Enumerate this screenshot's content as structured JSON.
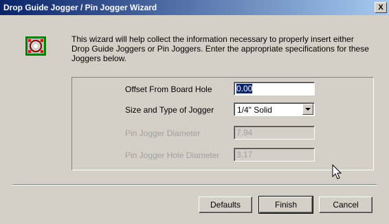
{
  "window": {
    "title": "Drop Guide Jogger / Pin Jogger Wizard",
    "close_label": "X"
  },
  "intro_text": "This wizard will help collect the information necessary to properly insert either Drop Guide Joggers or Pin Joggers.  Enter the appropriate specifications for these Joggers below.",
  "form": {
    "offset_label": "Offset From Board Hole",
    "offset_value": "0.00",
    "size_type_label": "Size and Type of Jogger",
    "size_type_value": "1/4\" Solid",
    "pin_diameter_label": "Pin Jogger Diameter",
    "pin_diameter_value": "7.94",
    "pin_hole_diameter_label": "Pin Jogger Hole Diameter",
    "pin_hole_diameter_value": "3.17"
  },
  "buttons": {
    "defaults": "Defaults",
    "finish": "Finish",
    "cancel": "Cancel"
  },
  "icons": {
    "wizard": "jogger-wizard-icon",
    "dropdown": "chevron-down-icon",
    "cursor": "mouse-pointer-icon"
  },
  "colors": {
    "titlebar_start": "#0a246a",
    "titlebar_end": "#a6caf0",
    "face": "#d4d0c8",
    "disabled_text": "#a0a0a0"
  }
}
